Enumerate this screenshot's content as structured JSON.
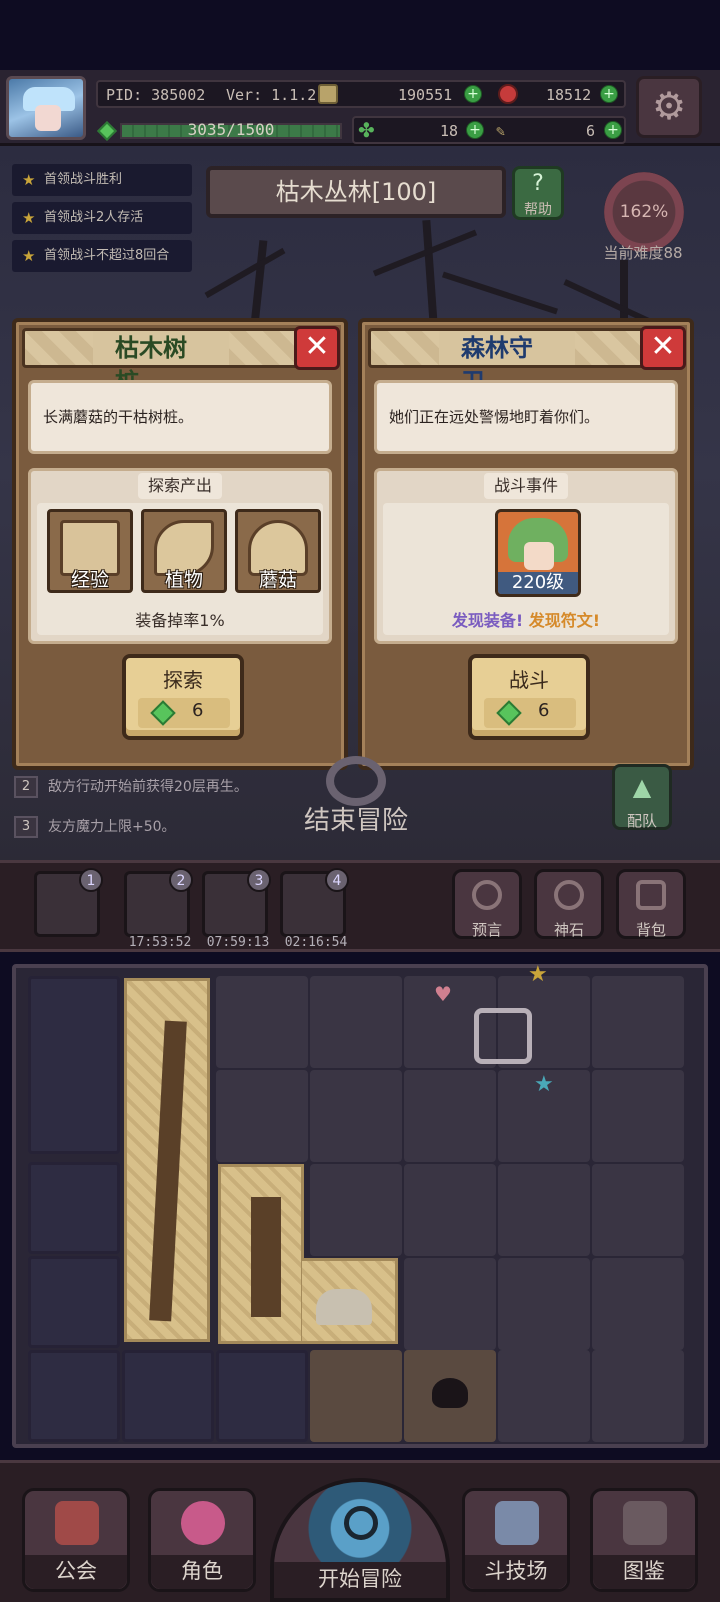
{
  "player": {
    "pid": "PID: 385002",
    "version": "Ver: 1.1.2.0",
    "xp_text": "3035/1500",
    "gold": "190551",
    "rubies": "18512",
    "clovers": "18",
    "tickets": "6"
  },
  "quests": [
    "首领战斗胜利",
    "首领战斗2人存活",
    "首领战斗不超过8回合"
  ],
  "map": {
    "title": "枯木丛林[100]",
    "help_label": "帮助",
    "difficulty_percent": "162%",
    "difficulty_label": "当前难度88"
  },
  "left_panel": {
    "title": "枯木树桩",
    "description": "长满蘑菇的干枯树桩。",
    "section_title": "探索产出",
    "items": [
      "经验",
      "植物",
      "蘑菇"
    ],
    "drop_rate": "装备掉率1%",
    "action_label": "探索",
    "cost": "6"
  },
  "right_panel": {
    "title": "森林守卫",
    "description": "她们正在远处警惕地盯着你们。",
    "section_title": "战斗事件",
    "enemy_level": "220级",
    "find_equipment": "发现装备!",
    "find_rune": "发现符文!",
    "action_label": "战斗",
    "cost": "6"
  },
  "rules": [
    {
      "num": "2",
      "text": "敌方行动开始前获得20层再生。"
    },
    {
      "num": "3",
      "text": "友方魔力上限+50。"
    }
  ],
  "end_adventure": "结束冒险",
  "team_label": "配队",
  "slots": [
    {
      "badge": "1",
      "timer": ""
    },
    {
      "badge": "2",
      "timer": "17:53:52"
    },
    {
      "badge": "3",
      "timer": "07:59:13"
    },
    {
      "badge": "4",
      "timer": "02:16:54"
    }
  ],
  "tools": [
    "预言",
    "神石",
    "背包"
  ],
  "nav": {
    "guild": "公会",
    "character": "角色",
    "start": "开始冒险",
    "arena": "斗技场",
    "codex": "图鉴"
  },
  "colors": {
    "gem": "#58c45c",
    "close": "#cf3a3a",
    "find_equipment": "#7a5cc0",
    "find_rune": "#d68a2a"
  }
}
